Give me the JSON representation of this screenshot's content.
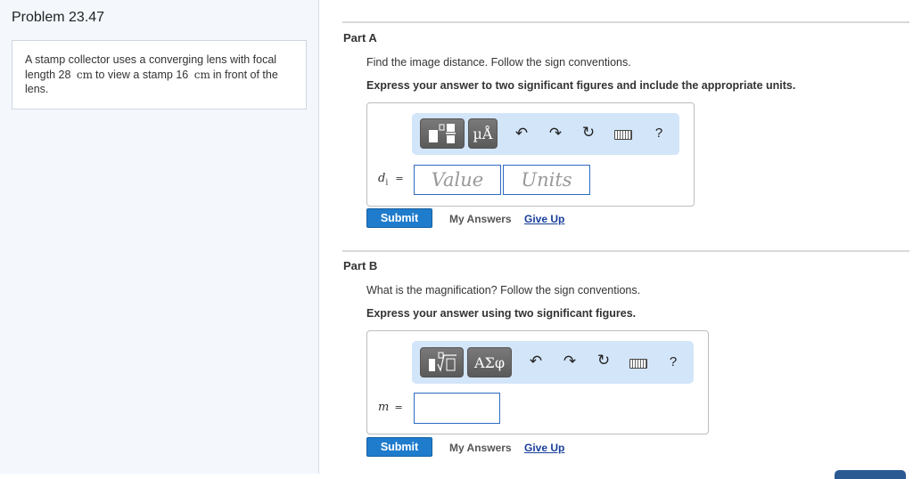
{
  "problem": {
    "title": "Problem 23.47",
    "statement": {
      "t1": "A stamp collector uses a converging lens with focal length 28",
      "u1": "cm",
      "t2": "to view a stamp 16",
      "u2": "cm",
      "t3": "in front of the lens."
    }
  },
  "part_a": {
    "title": "Part A",
    "question": "Find the image distance. Follow the sign conventions.",
    "instruction": "Express your answer to two significant figures and include the appropriate units.",
    "symbol_btn": "µÅ",
    "help": "?",
    "label": "d",
    "label_sub": "i",
    "equals": "=",
    "value_placeholder": "Value",
    "units_placeholder": "Units",
    "submit": "Submit",
    "my_answers": "My Answers",
    "give_up": "Give Up"
  },
  "part_b": {
    "title": "Part B",
    "question": "What is the magnification? Follow the sign conventions.",
    "instruction": "Express your answer using two significant figures.",
    "symbol_btn": "ΑΣφ",
    "help": "?",
    "label": "m",
    "equals": "=",
    "submit": "Submit",
    "my_answers": "My Answers",
    "give_up": "Give Up"
  }
}
